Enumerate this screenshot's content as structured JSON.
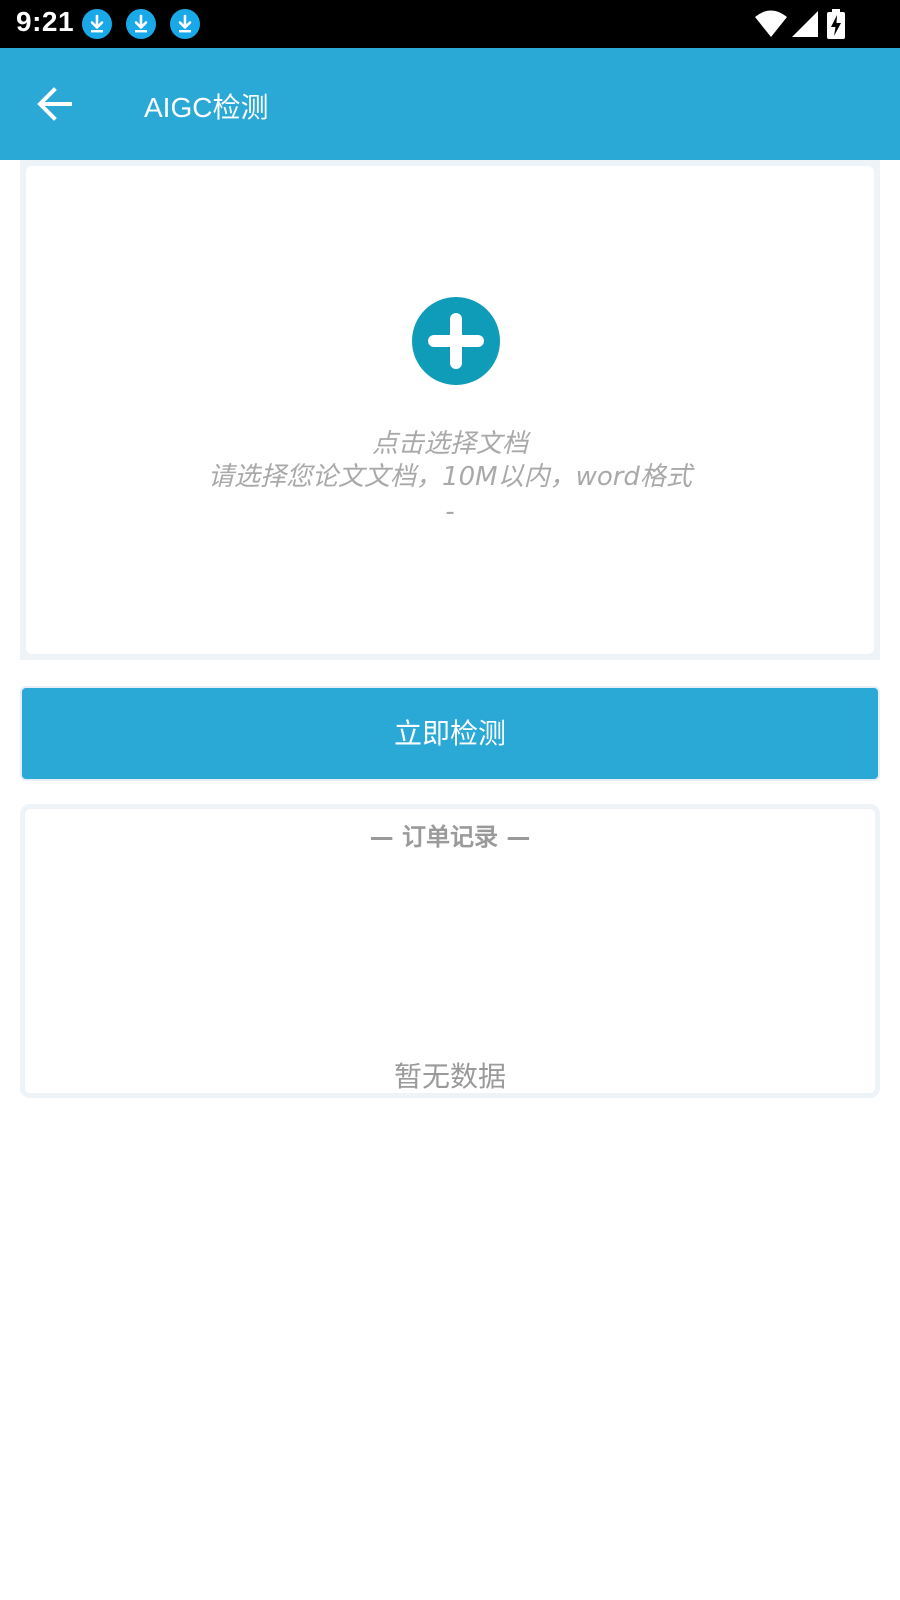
{
  "status_bar": {
    "time": "9:21",
    "notification_icons": [
      "download-icon",
      "download-icon",
      "download-icon"
    ],
    "system_icons": [
      "wifi-icon",
      "cell-signal-icon",
      "battery-charging-icon"
    ]
  },
  "app_bar": {
    "title": "AIGC检测",
    "back_icon": "arrow-left-icon",
    "background": "#2aa9d7"
  },
  "upload": {
    "icon": "plus-circle-icon",
    "icon_color": "#0f9cb8",
    "line1": "点击选择文档",
    "line2": "请选择您论文文档，10M以内，word格式",
    "line3": "-"
  },
  "check_button": {
    "label": "立即检测"
  },
  "orders": {
    "title": "— 订单记录 —",
    "empty_text": "暂无数据"
  },
  "colors": {
    "accent": "#2aa9d7",
    "muted_text": "#a9a9a9",
    "status_bar": "#000000"
  }
}
